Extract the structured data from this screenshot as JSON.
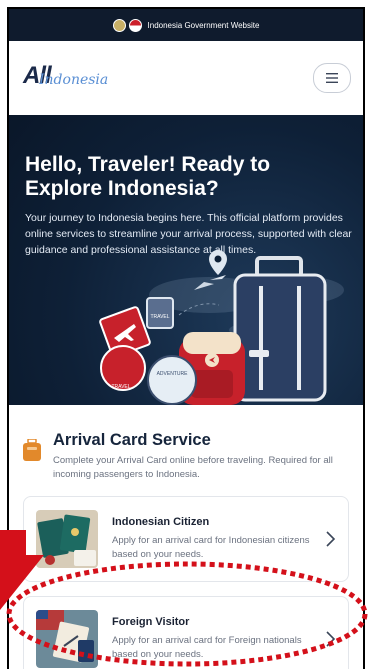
{
  "gov_bar": {
    "text": "Indonesia Government Website"
  },
  "header": {
    "logo_main": "All",
    "logo_sub": "Indonesia"
  },
  "hero": {
    "title": "Hello, Traveler! Ready to Explore Indonesia?",
    "description": "Your journey to Indonesia begins here. This official platform provides online services to streamline your arrival process, supported with clear guidance and professional assistance at all times.",
    "sticker_travel_1": "TRAVEL",
    "sticker_travel_2": "TRAVEL",
    "sticker_adventure": "ADVENTURE"
  },
  "service": {
    "title": "Arrival Card Service",
    "description": "Complete your Arrival Card online before traveling. Required for all incoming passengers to Indonesia."
  },
  "cards": [
    {
      "title": "Indonesian Citizen",
      "description": "Apply for an arrival card for Indonesian citizens based on your needs."
    },
    {
      "title": "Foreign Visitor",
      "description": "Apply for an arrival card for Foreign nationals based on your needs."
    }
  ],
  "colors": {
    "hero_bg": "#0e2037",
    "annotation_red": "#d4101a",
    "accent_orange": "#e2892b"
  }
}
